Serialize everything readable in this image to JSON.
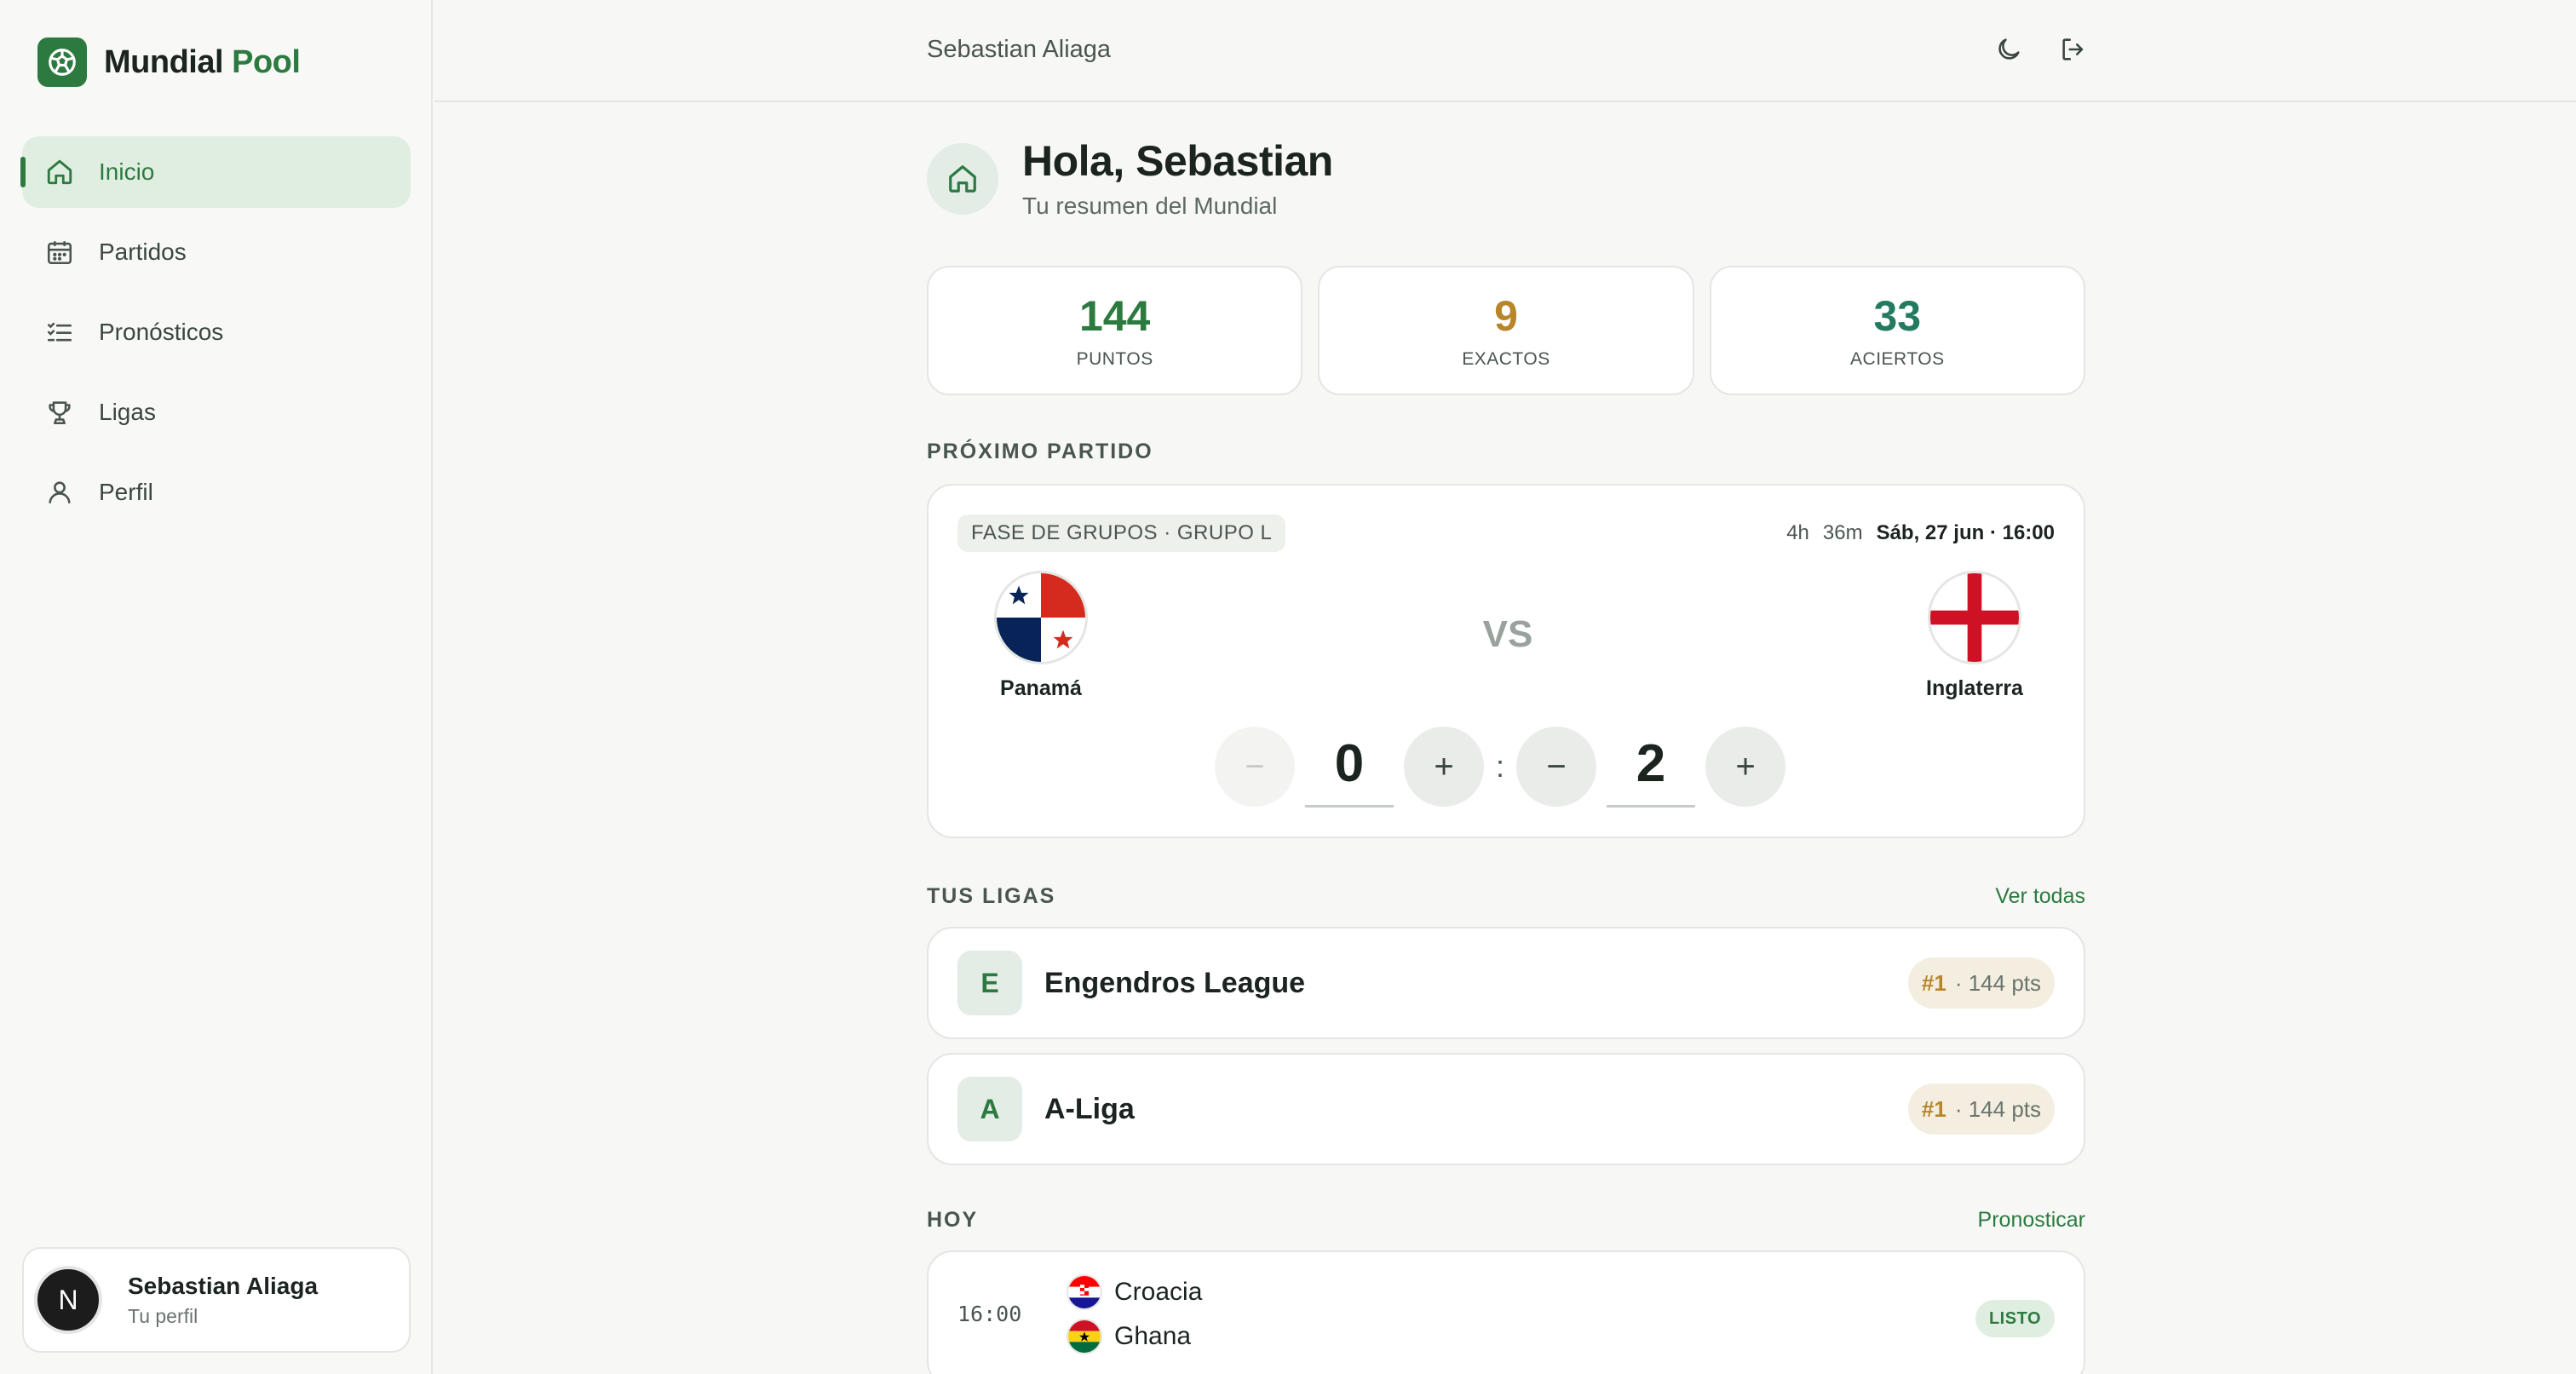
{
  "brand": {
    "name_primary": "Mundial",
    "name_accent": "Pool",
    "logo_icon": "soccer-ball-icon",
    "accent_color": "#2c7a3f"
  },
  "nav": [
    {
      "label": "Inicio",
      "icon": "home-icon",
      "active": true
    },
    {
      "label": "Partidos",
      "icon": "calendar-icon",
      "active": false
    },
    {
      "label": "Pronósticos",
      "icon": "checklist-icon",
      "active": false
    },
    {
      "label": "Ligas",
      "icon": "trophy-icon",
      "active": false
    },
    {
      "label": "Perfil",
      "icon": "user-icon",
      "active": false
    }
  ],
  "sidebar_user": {
    "avatar_initial": "N",
    "name": "Sebastian Aliaga",
    "subtitle": "Tu perfil"
  },
  "topbar": {
    "user_name": "Sebastian Aliaga",
    "theme_icon": "moon-icon",
    "logout_icon": "logout-icon"
  },
  "greeting": {
    "title": "Hola, Sebastian",
    "subtitle": "Tu resumen del Mundial",
    "icon": "home-icon"
  },
  "stats": [
    {
      "value": "144",
      "label": "PUNTOS",
      "color": "#2c7a3f"
    },
    {
      "value": "9",
      "label": "EXACTOS",
      "color": "#b8862a"
    },
    {
      "value": "33",
      "label": "ACIERTOS",
      "color": "#237a60"
    }
  ],
  "next_match": {
    "section_title": "PRÓXIMO PARTIDO",
    "phase": "FASE DE GRUPOS · GRUPO L",
    "countdown_hours": "4h",
    "countdown_minutes": "36m",
    "datetime": "Sáb, 27 jun · 16:00",
    "home_team": "Panamá",
    "away_team": "Inglaterra",
    "vs": "VS",
    "home_score": "0",
    "away_score": "2",
    "minus": "−",
    "plus": "+",
    "separator": ":"
  },
  "leagues": {
    "section_title": "TUS LIGAS",
    "link": "Ver todas",
    "items": [
      {
        "letter": "E",
        "name": "Engendros League",
        "rank": "#1",
        "points": "· 144 pts"
      },
      {
        "letter": "A",
        "name": "A-Liga",
        "rank": "#1",
        "points": "· 144 pts"
      }
    ]
  },
  "today": {
    "section_title": "HOY",
    "link": "Pronosticar",
    "matches": [
      {
        "time": "16:00",
        "home": "Croacia",
        "away": "Ghana",
        "status": "LISTO"
      }
    ]
  }
}
